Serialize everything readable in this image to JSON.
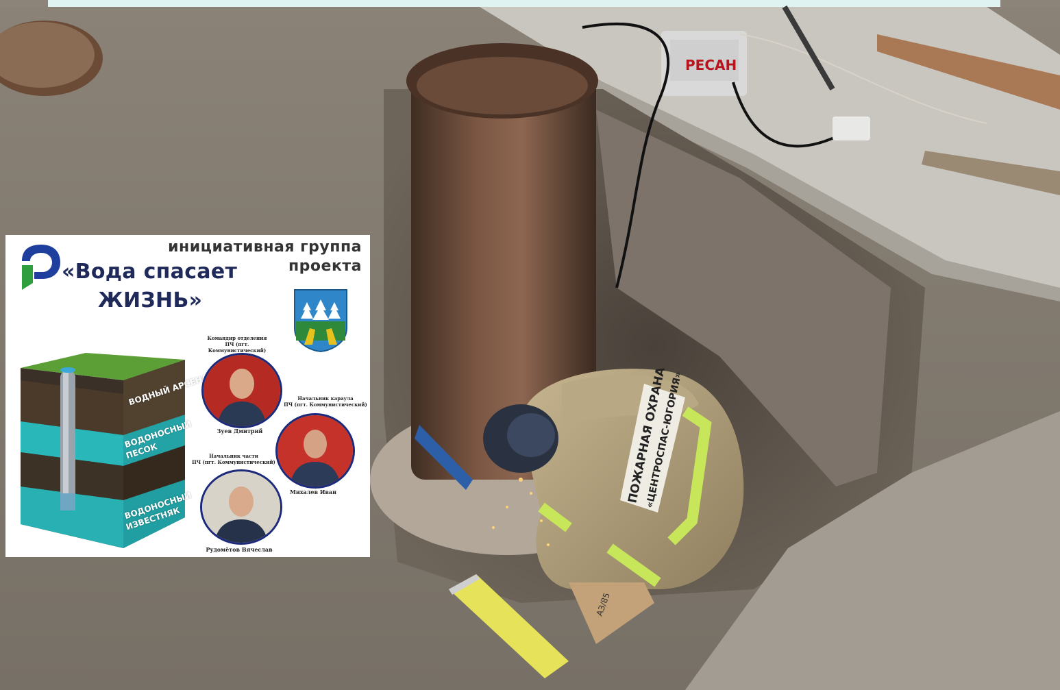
{
  "photo": {
    "welder_jacket_text_line1": "ПОЖАРНАЯ ОХРАНА",
    "welder_jacket_text_line2": "«ЦЕНТРОСПАС-ЮГОРИЯ»",
    "welding_machine_text": "РЕСАН",
    "cardboard_text": "АЗ/85"
  },
  "poster": {
    "heading_line1": "инициативная группа",
    "heading_line2": "проекта",
    "title_line1": "«Вода спасает",
    "title_line2": "ЖИЗНЬ»",
    "soil_labels": [
      "ВОДНЫЙ АРСЕНАЛ",
      "ВОДОНОСНЫЙ",
      "ПЕСОК",
      "ВОДОНОСНЫЙ",
      "ИЗВЕСТНЯК"
    ],
    "people": [
      {
        "role_line1": "Командир отделения",
        "role_line2": "ПЧ (пгт. Коммунистический)",
        "name": "Зуев Дмитрий"
      },
      {
        "role_line1": "Начальник караула",
        "role_line2": "ПЧ (пгт. Коммунистический)",
        "name": "Михалев Иван"
      },
      {
        "role_line1": "Начальник части",
        "role_line2": "ПЧ (пгт. Коммунистический)",
        "name": "Рудомётов Вячеслав"
      }
    ]
  },
  "colors": {
    "logo_blue": "#1f3f9e",
    "logo_green": "#2e9e3e",
    "title_navy": "#1f2a5a",
    "aquifer_teal": "#27b3b6",
    "portrait_ring": "#1b2a7a"
  }
}
